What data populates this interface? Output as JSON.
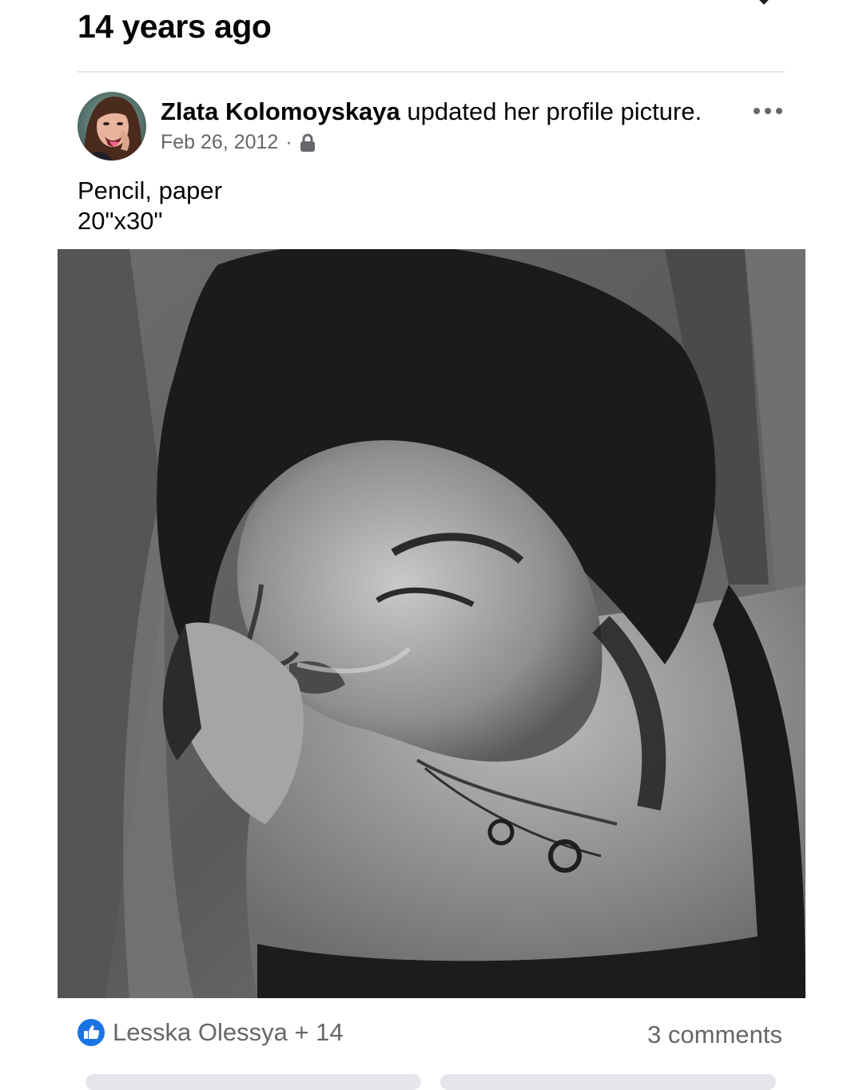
{
  "header": {
    "title": "14 years ago",
    "close_icon": "close-icon"
  },
  "post": {
    "author": "Zlata Kolomoyskaya",
    "action": "updated her profile picture.",
    "date": "Feb 26, 2012",
    "separator": "·",
    "privacy_icon": "lock-icon",
    "more_icon": "more-dots-icon",
    "caption_lines": [
      "Pencil, paper",
      "20\"x30\""
    ]
  },
  "footer": {
    "reaction_icon": "like-icon",
    "reactions_text": "Lesska Olessya + 14",
    "comments_text": "3 comments"
  },
  "colors": {
    "like_blue": "#1b74e4",
    "secondary_text": "#65676b",
    "divider": "#e4e6eb"
  }
}
